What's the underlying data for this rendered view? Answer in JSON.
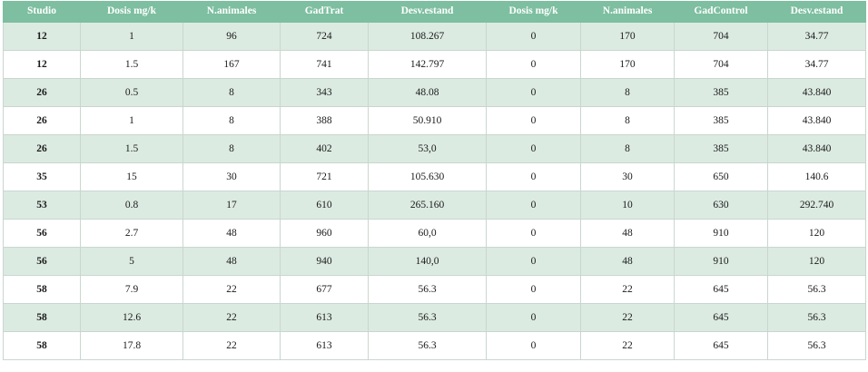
{
  "table": {
    "headers": [
      "Studio",
      "Dosis mg/k",
      "N.animales",
      "GadTrat",
      "Desv.estand",
      "Dosis mg/k",
      "N.animales",
      "GadControl",
      "Desv.estand"
    ],
    "rows": [
      [
        "12",
        "1",
        "96",
        "724",
        "108.267",
        "0",
        "170",
        "704",
        "34.77"
      ],
      [
        "12",
        "1.5",
        "167",
        "741",
        "142.797",
        "0",
        "170",
        "704",
        "34.77"
      ],
      [
        "26",
        "0.5",
        "8",
        "343",
        "48.08",
        "0",
        "8",
        "385",
        "43.840"
      ],
      [
        "26",
        "1",
        "8",
        "388",
        "50.910",
        "0",
        "8",
        "385",
        "43.840"
      ],
      [
        "26",
        "1.5",
        "8",
        "402",
        "53,0",
        "0",
        "8",
        "385",
        "43.840"
      ],
      [
        "35",
        "15",
        "30",
        "721",
        "105.630",
        "0",
        "30",
        "650",
        "140.6"
      ],
      [
        "53",
        "0.8",
        "17",
        "610",
        "265.160",
        "0",
        "10",
        "630",
        "292.740"
      ],
      [
        "56",
        "2.7",
        "48",
        "960",
        "60,0",
        "0",
        "48",
        "910",
        "120"
      ],
      [
        "56",
        "5",
        "48",
        "940",
        "140,0",
        "0",
        "48",
        "910",
        "120"
      ],
      [
        "58",
        "7.9",
        "22",
        "677",
        "56.3",
        "0",
        "22",
        "645",
        "56.3"
      ],
      [
        "58",
        "12.6",
        "22",
        "613",
        "56.3",
        "0",
        "22",
        "645",
        "56.3"
      ],
      [
        "58",
        "17.8",
        "22",
        "613",
        "56.3",
        "0",
        "22",
        "645",
        "56.3"
      ]
    ]
  },
  "colors": {
    "header_bg": "#7dbfa0",
    "header_text": "#ffffff",
    "row_alt_bg": "#dcebe2",
    "row_bg": "#ffffff",
    "grid_line": "#c9d6cf"
  }
}
